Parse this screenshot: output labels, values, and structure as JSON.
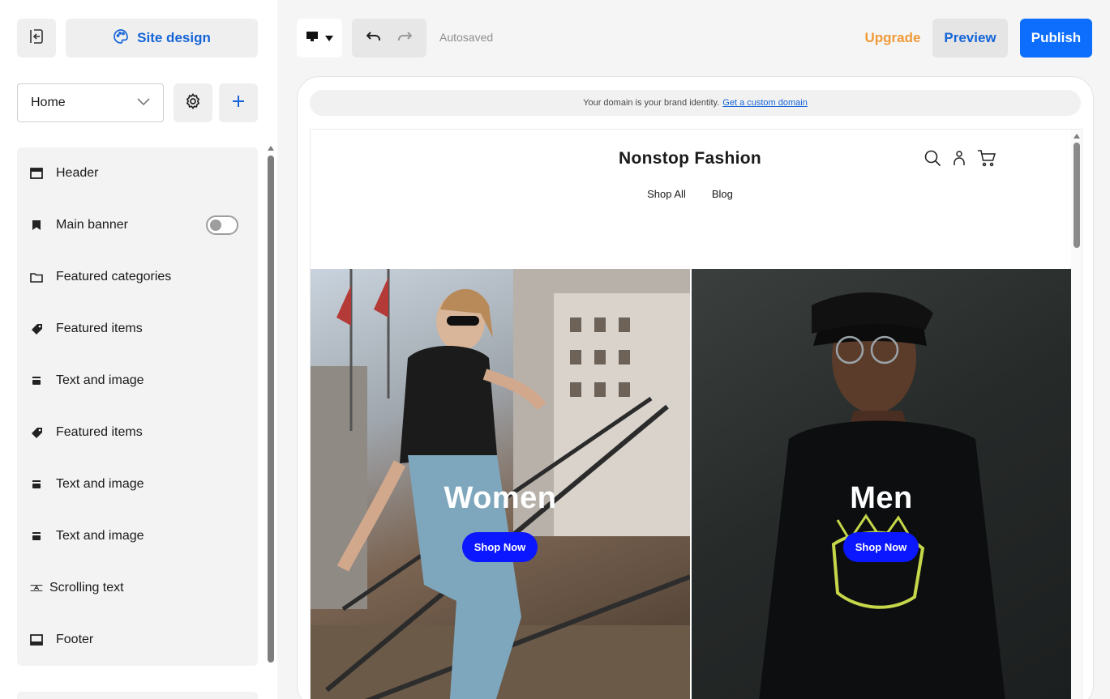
{
  "sidebar": {
    "site_design_label": "Site design",
    "page_select_value": "Home",
    "sections": [
      {
        "label": "Header",
        "icon": "header-icon"
      },
      {
        "label": "Main banner",
        "icon": "bookmark-icon",
        "toggle": "off"
      },
      {
        "label": "Featured categories",
        "icon": "folder-icon"
      },
      {
        "label": "Featured items",
        "icon": "tag-icon"
      },
      {
        "label": "Text and image",
        "icon": "text-image-icon"
      },
      {
        "label": "Featured items",
        "icon": "tag-icon"
      },
      {
        "label": "Text and image",
        "icon": "text-image-icon"
      },
      {
        "label": "Text and image",
        "icon": "text-image-icon"
      },
      {
        "label": "Scrolling text",
        "icon": "scrolling-text-icon"
      },
      {
        "label": "Footer",
        "icon": "footer-icon"
      }
    ]
  },
  "toolbar": {
    "autosaved": "Autosaved",
    "upgrade": "Upgrade",
    "preview": "Preview",
    "publish": "Publish"
  },
  "canvas": {
    "domain_text": "Your domain is your brand identity.",
    "domain_link": "Get a custom domain",
    "store_name": "Nonstop Fashion",
    "nav": [
      "Shop All",
      "Blog"
    ],
    "heroes": [
      {
        "title": "Women",
        "cta": "Shop Now"
      },
      {
        "title": "Men",
        "cta": "Shop Now"
      }
    ]
  },
  "colors": {
    "accent_blue": "#1565d8",
    "publish_blue": "#0d6efd",
    "upgrade_orange": "#f09a38",
    "cta_blue": "#0a17ff"
  }
}
